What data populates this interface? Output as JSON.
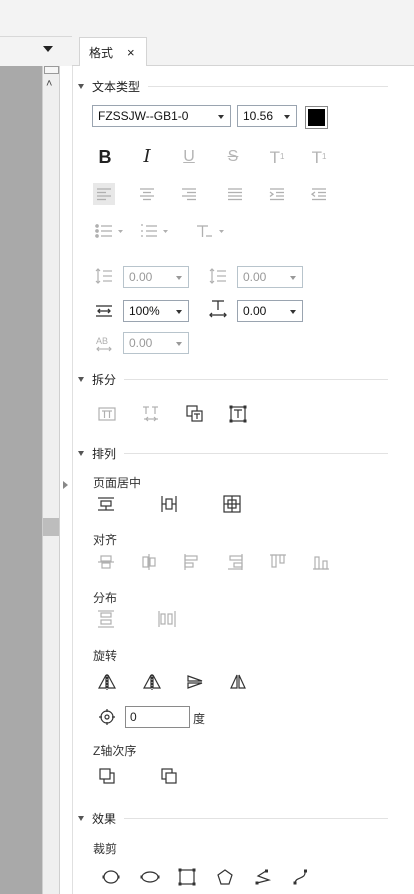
{
  "tab": {
    "title": "格式",
    "close": "×"
  },
  "sections": {
    "text_type": "文本类型",
    "split": "拆分",
    "arrange": "排列",
    "effect": "效果"
  },
  "font": {
    "family": "FZSSJW--GB1-0",
    "size": "10.56",
    "color": "#000000"
  },
  "text_style_buttons": [
    {
      "name": "bold",
      "glyph": "B"
    },
    {
      "name": "italic",
      "glyph": "I"
    },
    {
      "name": "underline",
      "glyph": "U"
    },
    {
      "name": "strikethrough",
      "glyph": "S"
    },
    {
      "name": "superscript",
      "glyph": "T"
    },
    {
      "name": "subscript",
      "glyph": "T"
    }
  ],
  "spacing": {
    "line_before": "0.00",
    "line_after": "0.00",
    "scale": "100%",
    "char_spacing": "0.00",
    "kerning": "0.00"
  },
  "arrange": {
    "page_center_label": "页面居中",
    "align_label": "对齐",
    "distribute_label": "分布",
    "rotate_label": "旋转",
    "rotate_value": "0",
    "rotate_unit": "度",
    "z_order_label": "Z轴次序"
  },
  "effect": {
    "crop_label": "裁剪"
  }
}
